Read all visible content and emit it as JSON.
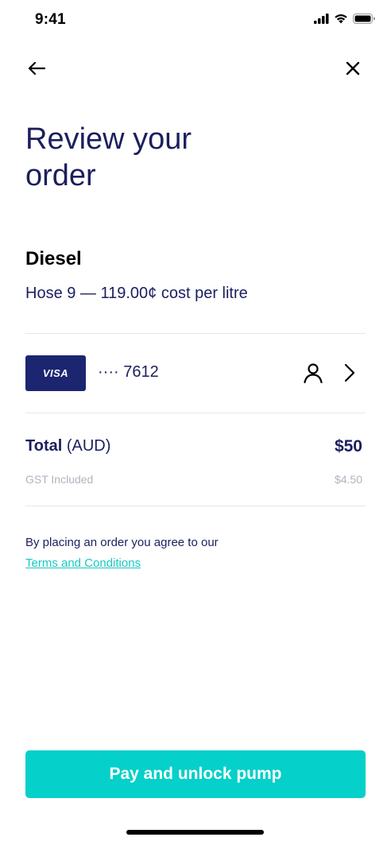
{
  "status_bar": {
    "time": "9:41",
    "icons": [
      "cellular-signal-icon",
      "wifi-icon",
      "battery-icon"
    ]
  },
  "nav": {
    "back_icon": "arrow-left-icon",
    "close_icon": "close-icon"
  },
  "header": {
    "title_line1": "Review your",
    "title_line2": "order"
  },
  "fuel": {
    "name": "Diesel",
    "detail": "Hose 9 — 119.00¢ cost per litre"
  },
  "payment": {
    "card_brand": "VISA",
    "card_number": "···· 7612",
    "user_icon": "user-icon",
    "chevron_icon": "chevron-right-icon"
  },
  "total": {
    "label": "Total",
    "currency": "(AUD)",
    "amount": "$50",
    "gst_label": "GST Included",
    "gst_amount": "$4.50"
  },
  "agreement": {
    "text": "By placing an order you agree to our",
    "link": "Terms and Conditions"
  },
  "actions": {
    "pay_label": "Pay and unlock pump"
  },
  "colors": {
    "text_primary": "#1b1f5e",
    "accent": "#05d0c9",
    "link": "#19c7c4",
    "card": "#1c2670",
    "muted": "#b1b3be",
    "divider": "#e6e7ec"
  }
}
